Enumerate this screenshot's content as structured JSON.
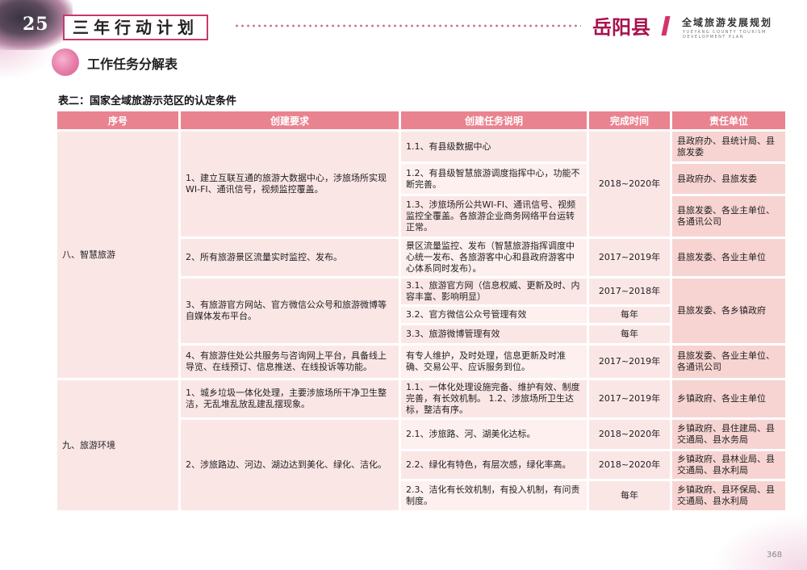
{
  "header": {
    "page_badge": "25",
    "title": "三年行动计划",
    "brand_name": "岳阳县",
    "brand_subtitle": "全域旅游发展规划",
    "brand_english": "YUEYANG COUNTY TOURISM DEVELOPMENT PLAN"
  },
  "section_title": "工作任务分解表",
  "table_caption": "表二：国家全域旅游示范区的认定条件",
  "table": {
    "headers": [
      "序号",
      "创建要求",
      "创建任务说明",
      "完成时间",
      "责任单位"
    ],
    "cat8": "八、智慧旅游",
    "cat9": "九、旅游环境",
    "r8_1": "1、建立互联互通的旅游大数据中心，涉旅场所实现WI-FI、通讯信号，视频监控覆盖。",
    "r8_1_1": "1.1、有县级数据中心",
    "r8_1_1_u": "县政府办、县统计局、县旅发委",
    "r8_1_2": "1.2、有县级智慧旅游调度指挥中心，功能不断完善。",
    "r8_1_2_u": "县政府办、县旅发委",
    "r8_1_t": "2018~2020年",
    "r8_1_3": "1.3、涉旅场所公共WI-FI、通讯信号、视频监控全覆盖。各旅游企业商务网络平台运转正常。",
    "r8_1_3_u": "县旅发委、各业主单位、各通讯公司",
    "r8_2": "2、所有旅游景区流量实时监控、发布。",
    "r8_2_d": "景区流量监控、发布（智慧旅游指挥调度中心统一发布、各旅游客中心和县政府游客中心体系同时发布）。",
    "r8_2_t": "2017~2019年",
    "r8_2_u": "县旅发委、各业主单位",
    "r8_3": "3、有旅游官方网站、官方微信公众号和旅游微博等自媒体发布平台。",
    "r8_3_1": "3.1、旅游官方网（信息权威、更新及时、内容丰富、影响明显）",
    "r8_3_1_t": "2017~2018年",
    "r8_3_u": "县旅发委、各乡镇政府",
    "r8_3_2": "3.2、官方微信公众号管理有效",
    "r8_3_2_t": "每年",
    "r8_3_3": "3.3、旅游微博管理有效",
    "r8_3_3_t": "每年",
    "r8_4": "4、有旅游住处公共服务与咨询网上平台，具备线上导览、在线预订、信息推送、在线投诉等功能。",
    "r8_4_d": "有专人维护，及时处理，信息更新及时准确、交易公平、应诉服务到位。",
    "r8_4_t": "2017~2019年",
    "r8_4_u": "县旅发委、各业主单位、各通讯公司",
    "r9_1": "1、城乡垃圾一体化处理，主要涉旅场所干净卫生整洁，无乱堆乱放乱建乱摆现象。",
    "r9_1_d": "1.1、一体化处理设施完备、维护有效、制度完善，有长效机制。 1.2、涉旅场所卫生达标，整洁有序。",
    "r9_1_t": "2017~2019年",
    "r9_1_u": "乡镇政府、各业主单位",
    "r9_2": "2、涉旅路边、河边、湖边达到美化、绿化、洁化。",
    "r9_2_1": "2.1、涉旅路、河、湖美化达标。",
    "r9_2_1_t": "2018~2020年",
    "r9_2_1_u": "乡镇政府、县住建局、县交通局、县水务局",
    "r9_2_2": "2.2、绿化有特色，有层次感，绿化率高。",
    "r9_2_2_t": "2018~2020年",
    "r9_2_2_u": "乡镇政府、县林业局、县交通局、县水利局",
    "r9_2_3": "2.3、洁化有长效机制，有投入机制，有问责制度。",
    "r9_2_3_t": "每年",
    "r9_2_3_u": "乡镇政府、县环保局、县交通局、县水利局"
  },
  "page_number": "368",
  "colors": {
    "header_row": "#e9838f",
    "cell": "#fbe6e6",
    "unit_cell": "#f7d4d2",
    "accent": "#c73a6a"
  }
}
